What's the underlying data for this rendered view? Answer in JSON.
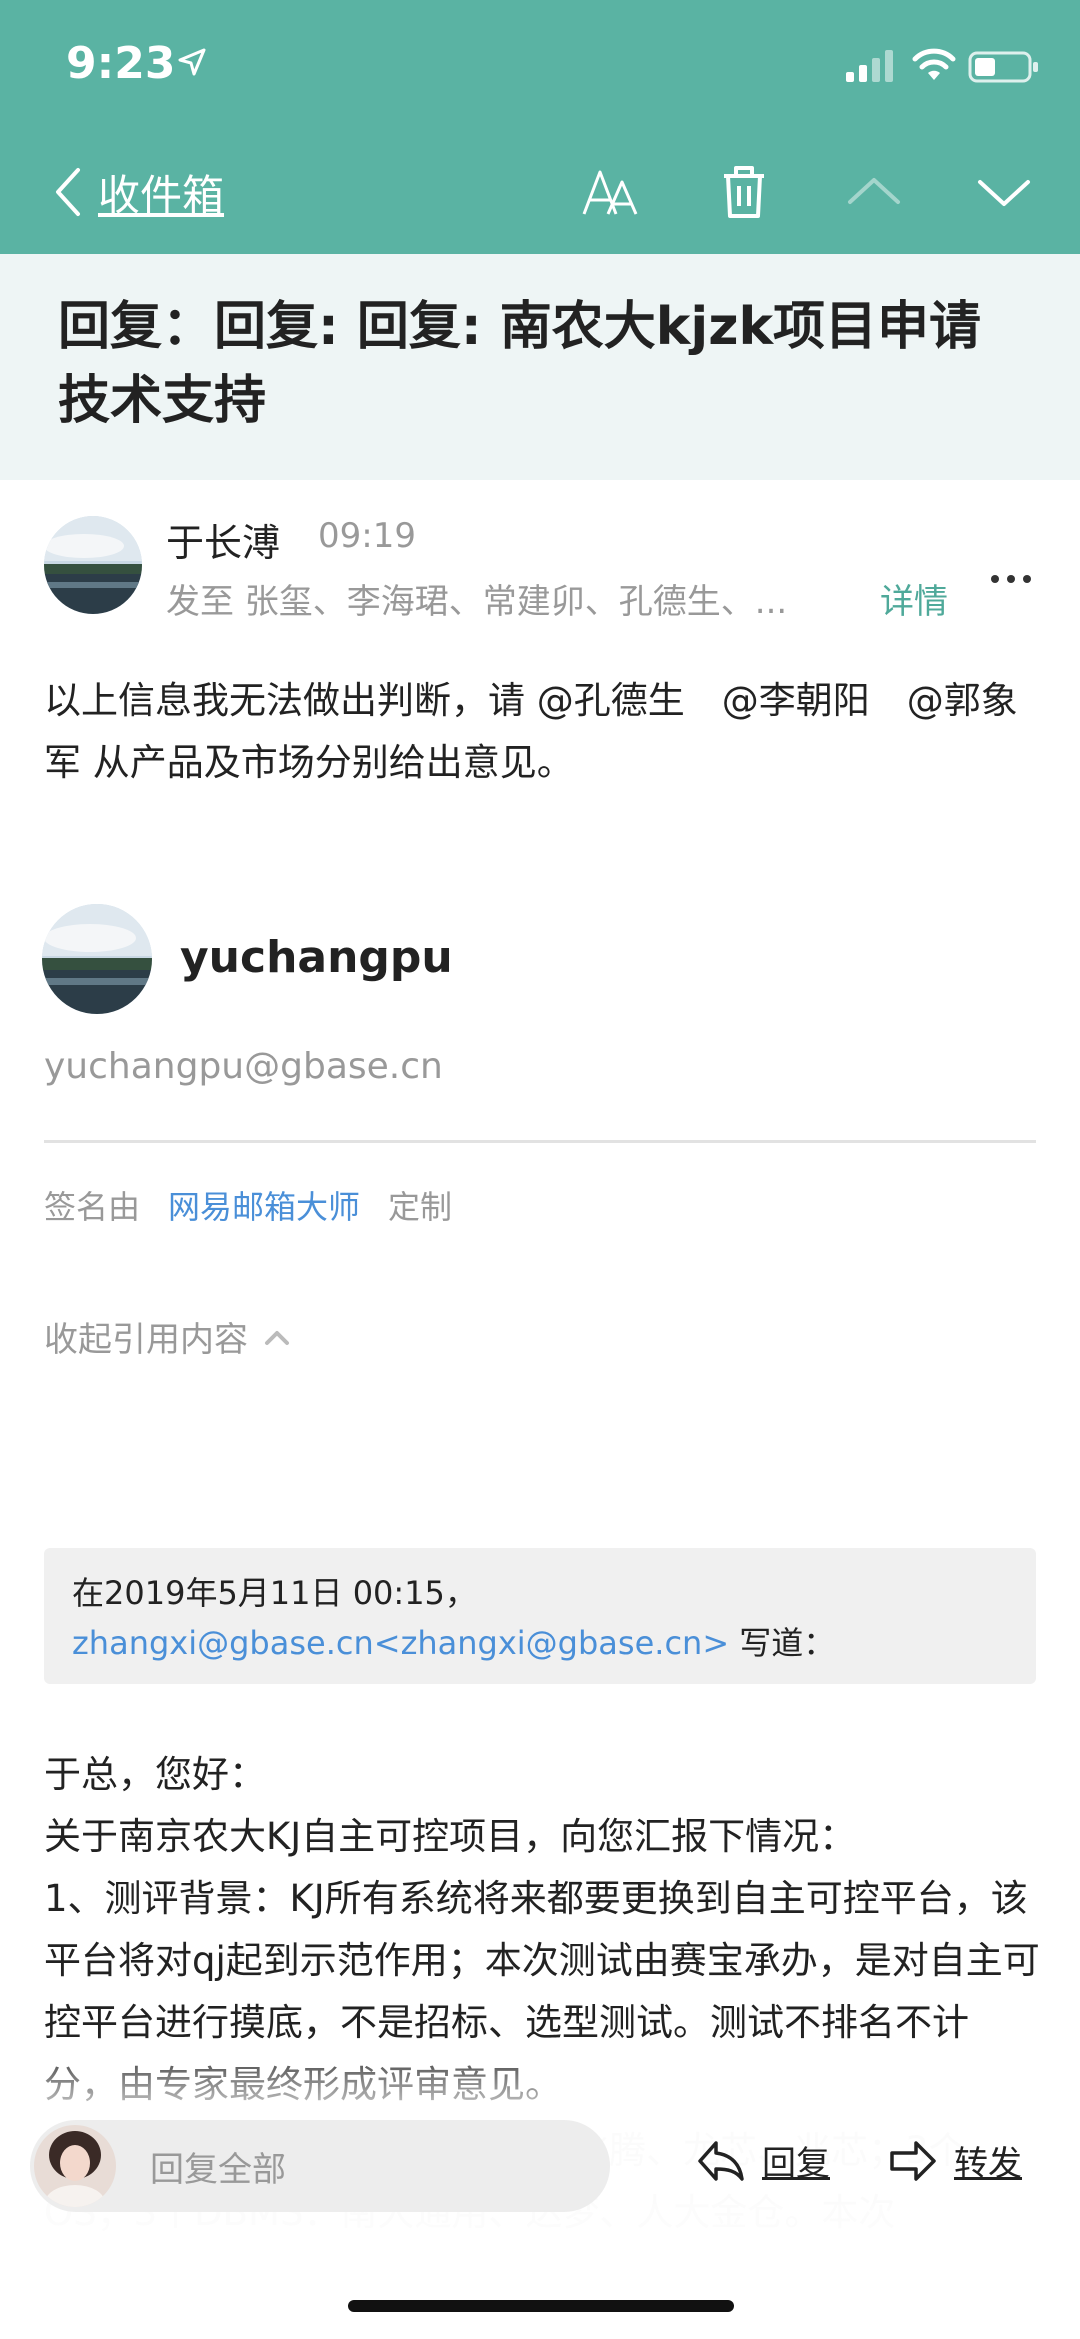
{
  "status_bar": {
    "time": "9:23"
  },
  "nav": {
    "back_label": "收件箱"
  },
  "email": {
    "subject": "回复：回复: 回复: 南农大kjzk项目申请技术支持",
    "sender_name": "于长溥",
    "time": "09:19",
    "recipients": "发至 张玺、李海珺、常建卯、孔德生、...",
    "details_label": "详情",
    "body_paragraphs": [
      "以上信息我无法做出判断，请 @孔德生　@李朝阳　@郭象军 从产品及市场分别给出意见。"
    ]
  },
  "signature": {
    "name": "yuchangpu",
    "email": "yuchangpu@gbase.cn",
    "signed_by_label": "签名由",
    "signed_by_app": "网易邮箱大师",
    "customize_label": "定制"
  },
  "collapse_quote_label": "收起引用内容",
  "quote_header": {
    "prefix": "在2019年5月11日 00:15，",
    "link": "zhangxi@gbase.cn<zhangxi@gbase.cn>",
    "suffix": " 写道："
  },
  "quoted_body": [
    "于总，您好：",
    "关于南京农大KJ自主可控项目，向您汇报下情况：",
    "1、测评背景：KJ所有系统将来都要更换到自主可控平台，该平台将对qj起到示范作用；本次测试由赛宝承办，是对自主可控平台进行摸底，不是招标、选型测试。测试不排名不计分，由专家最终形成评审意见。"
  ],
  "quoted_faded": "2、测评内容：4个平台：海思、飞腾、龙芯、兆芯；3个OS；3个DBMS：南大通用、达梦、人大金仓。本次",
  "bottom_bar": {
    "reply_all_label": "回复全部",
    "reply_label": "回复",
    "forward_label": "转发"
  },
  "colors": {
    "header_teal": "#5ab3a3",
    "link_blue": "#4a8fd8",
    "details_green": "#4fa99a"
  }
}
